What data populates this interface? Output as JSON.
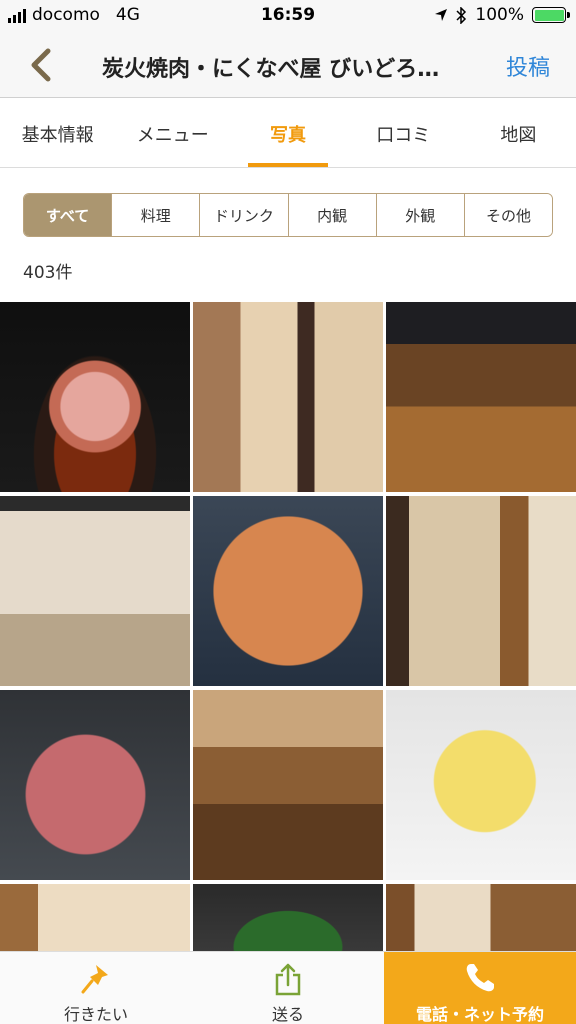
{
  "status_bar": {
    "carrier": "docomo",
    "network": "4G",
    "time": "16:59",
    "battery": "100%",
    "battery_level": 1.0,
    "signal_bars": 4
  },
  "nav": {
    "back_icon": "chevron-left-icon",
    "title": "炭火焼肉・にくなべ屋 びいどろ…",
    "post_label": "投稿"
  },
  "tabs": [
    {
      "label": "基本情報",
      "active": false
    },
    {
      "label": "メニュー",
      "active": false
    },
    {
      "label": "写真",
      "active": true
    },
    {
      "label": "口コミ",
      "active": false
    },
    {
      "label": "地図",
      "active": false
    }
  ],
  "filters": [
    {
      "label": "すべて",
      "active": true
    },
    {
      "label": "料理",
      "active": false
    },
    {
      "label": "ドリンク",
      "active": false
    },
    {
      "label": "内観",
      "active": false
    },
    {
      "label": "外観",
      "active": false
    },
    {
      "label": "その他",
      "active": false
    }
  ],
  "photo_count": "403件",
  "photos": [
    {
      "name": "photo-nabe"
    },
    {
      "name": "photo-entrance-stairs"
    },
    {
      "name": "photo-grill-table"
    },
    {
      "name": "photo-storefront"
    },
    {
      "name": "photo-pancake"
    },
    {
      "name": "photo-private-room"
    },
    {
      "name": "photo-wagyu"
    },
    {
      "name": "photo-dining-room"
    },
    {
      "name": "photo-butter"
    },
    {
      "name": "photo-room-partial"
    },
    {
      "name": "photo-salad-partial"
    },
    {
      "name": "photo-hall-partial"
    }
  ],
  "bottom_bar": {
    "want_to_go": "行きたい",
    "send": "送る",
    "reserve": "電話・ネット予約"
  },
  "colors": {
    "accent_orange": "#f19a0d",
    "cta_orange": "#f3a81a",
    "filter_active": "#ab9670",
    "link_blue": "#2f86d8"
  }
}
